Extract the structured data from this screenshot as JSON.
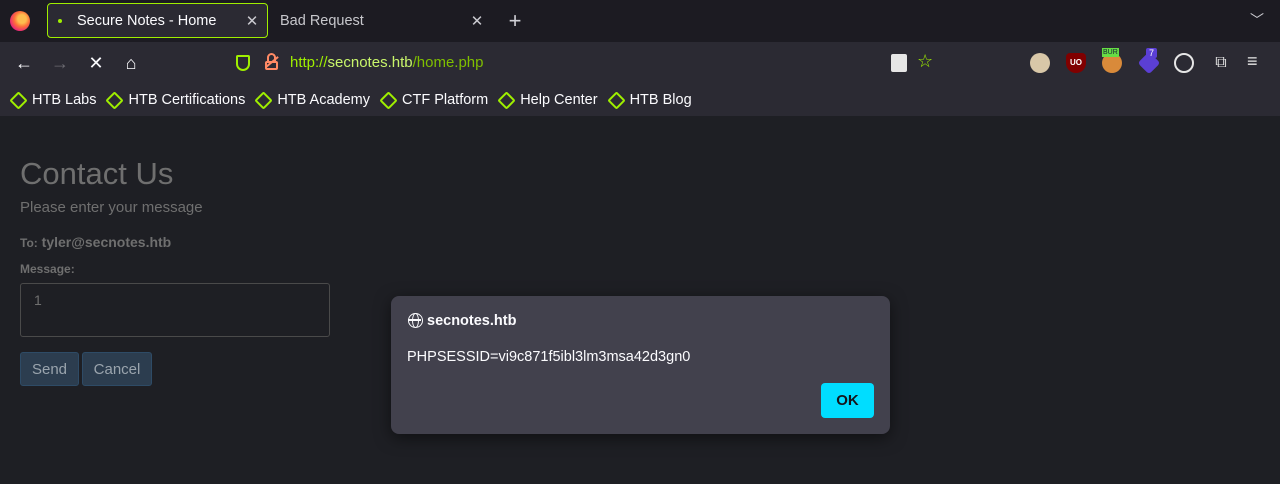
{
  "tabs": [
    {
      "title": "Secure Notes - Home",
      "active": true
    },
    {
      "title": "Bad Request",
      "active": false
    }
  ],
  "toolbar": {
    "url_scheme": "http://",
    "url_host": "secnotes.htb",
    "url_path": "/home.php"
  },
  "bookmarks": [
    {
      "label": "HTB Labs"
    },
    {
      "label": "HTB Certifications"
    },
    {
      "label": "HTB Academy"
    },
    {
      "label": "CTF Platform"
    },
    {
      "label": "Help Center"
    },
    {
      "label": "HTB Blog"
    }
  ],
  "extensions": {
    "burp_badge": "BUR",
    "counter_badge": "7",
    "ublock_label": "UO"
  },
  "page": {
    "title": "Contact Us",
    "subtitle": "Please enter your message",
    "to_label": "To:",
    "to_value": "tyler@secnotes.htb",
    "message_label": "Message:",
    "message_value": "1",
    "send_label": "Send",
    "cancel_label": "Cancel"
  },
  "dialog": {
    "site": "secnotes.htb",
    "message": "PHPSESSID=vi9c871f5ibl3lm3msa42d3gn0",
    "ok_label": "OK"
  },
  "colors": {
    "accent": "#9fef00",
    "ok_button": "#00ddff"
  }
}
